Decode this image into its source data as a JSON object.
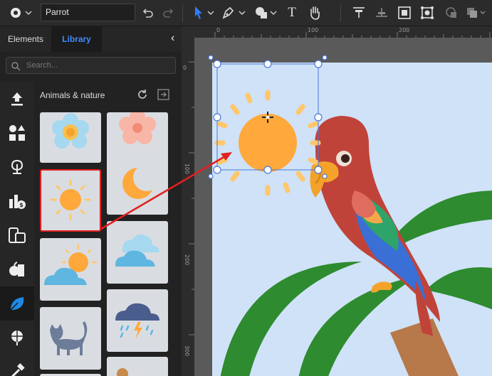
{
  "toolbar": {
    "document_name": "Parrot",
    "icons": [
      "logo-icon",
      "undo-icon",
      "redo-icon",
      "select-arrow-icon",
      "pen-icon",
      "shapes-icon",
      "text-icon",
      "hand-icon",
      "align-top-icon",
      "align-middle-icon",
      "fit-icon",
      "group-icon",
      "mask-icon",
      "arrange-icon"
    ],
    "text_tool_glyph": "T"
  },
  "left_panel": {
    "tabs": [
      {
        "label": "Elements",
        "active": false
      },
      {
        "label": "Library",
        "active": true
      }
    ],
    "collapse_glyph": "‹",
    "search": {
      "placeholder": "Search..."
    },
    "category_title": "Animals & nature",
    "sidebar_icons": [
      "upload-icon",
      "shapes-category-icon",
      "plant-icon",
      "finance-icon",
      "devices-icon",
      "food-icon",
      "nature-leaf-icon",
      "sport-icon",
      "tools-icon"
    ],
    "items": [
      "flower-blue",
      "flower-pink",
      "sun",
      "moon",
      "sun-behind-cloud",
      "clouds",
      "cat",
      "storm-cloud"
    ]
  },
  "canvas": {
    "ruler_top_labels": [
      "0",
      "100",
      "200"
    ],
    "ruler_left_labels": [
      "0",
      "100",
      "200",
      "300"
    ]
  },
  "colors": {
    "accent": "#3d8bff",
    "selection_highlight": "#e2201f",
    "sun": "#ffa83c",
    "artboard_bg": "#cfe2f7"
  }
}
